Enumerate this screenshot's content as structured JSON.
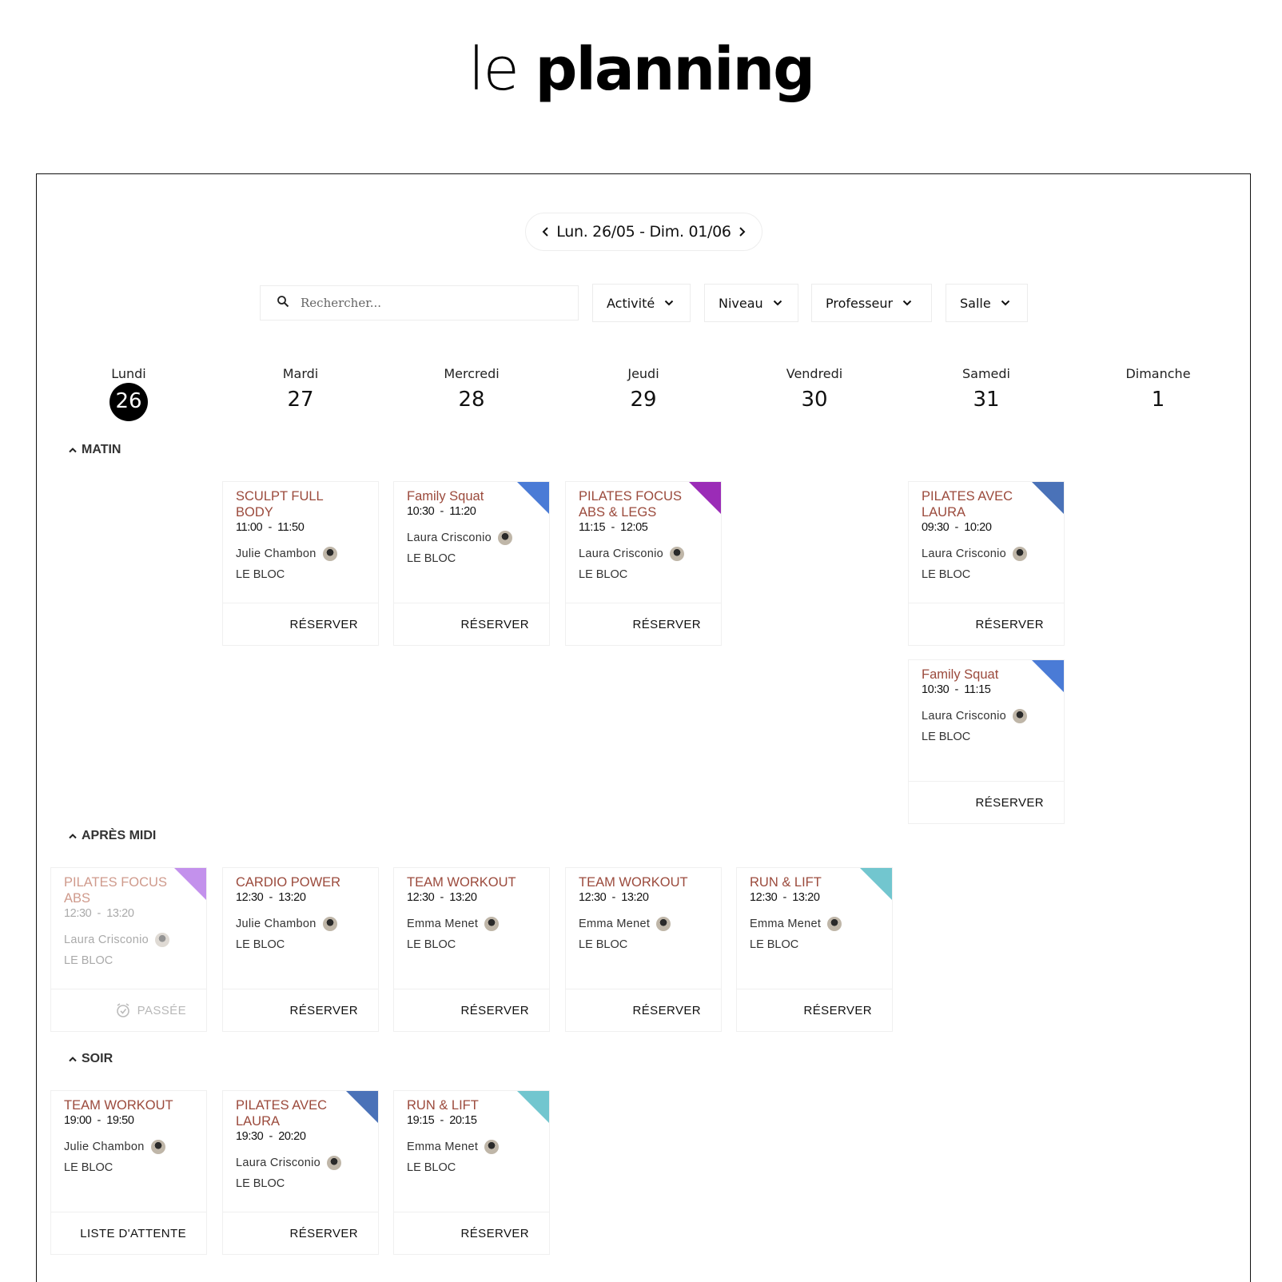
{
  "page": {
    "title_light": "le",
    "title_bold": "planning"
  },
  "week_nav": {
    "label": "Lun. 26/05 - Dim. 01/06"
  },
  "search": {
    "placeholder": "Rechercher..."
  },
  "filters": [
    "Activité",
    "Niveau",
    "Professeur",
    "Salle"
  ],
  "days": [
    {
      "name": "Lundi",
      "num": "26",
      "today": true
    },
    {
      "name": "Mardi",
      "num": "27"
    },
    {
      "name": "Mercredi",
      "num": "28"
    },
    {
      "name": "Jeudi",
      "num": "29"
    },
    {
      "name": "Vendredi",
      "num": "30"
    },
    {
      "name": "Samedi",
      "num": "31"
    },
    {
      "name": "Dimanche",
      "num": "1"
    }
  ],
  "sections": [
    "MATIN",
    "APRÈS MIDI",
    "SOIR"
  ],
  "colors": {
    "blue": "#4a7bd6",
    "purple": "#9b2cb7",
    "lavender": "#c391ec",
    "teal": "#72c6cf",
    "steel": "#4a72b8",
    "title_red": "#9b4a3c"
  },
  "classes": [
    {
      "section": 0,
      "day": 1,
      "slot": 0,
      "title": "SCULPT FULL BODY",
      "time": "11:00  -  11:50",
      "coach": "Julie Chambon",
      "room": "LE BLOC",
      "action": "RÉSERVER",
      "tag": ""
    },
    {
      "section": 0,
      "day": 2,
      "slot": 0,
      "title": "Family Squat",
      "time": "10:30  -  11:20",
      "coach": "Laura Crisconio",
      "room": "LE BLOC",
      "action": "RÉSERVER",
      "tag": "blue"
    },
    {
      "section": 0,
      "day": 3,
      "slot": 0,
      "title": "PILATES FOCUS ABS & LEGS",
      "time": "11:15  -  12:05",
      "coach": "Laura Crisconio",
      "room": "LE BLOC",
      "action": "RÉSERVER",
      "tag": "purple"
    },
    {
      "section": 0,
      "day": 5,
      "slot": 0,
      "title": "PILATES AVEC LAURA",
      "time": "09:30  -  10:20",
      "coach": "Laura Crisconio",
      "room": "LE BLOC",
      "action": "RÉSERVER",
      "tag": "steel"
    },
    {
      "section": 0,
      "day": 5,
      "slot": 1,
      "title": "Family Squat",
      "time": "10:30  -  11:15",
      "coach": "Laura Crisconio",
      "room": "LE BLOC",
      "action": "RÉSERVER",
      "tag": "blue"
    },
    {
      "section": 1,
      "day": 0,
      "slot": 0,
      "title": "PILATES FOCUS ABS",
      "time": "12:30  -  13:20",
      "coach": "Laura Crisconio",
      "room": "LE BLOC",
      "action": "PASSÉE",
      "tag": "lavender",
      "past": true
    },
    {
      "section": 1,
      "day": 1,
      "slot": 0,
      "title": "CARDIO POWER",
      "time": "12:30  -  13:20",
      "coach": "Julie Chambon",
      "room": "LE BLOC",
      "action": "RÉSERVER",
      "tag": ""
    },
    {
      "section": 1,
      "day": 2,
      "slot": 0,
      "title": "TEAM WORKOUT",
      "time": "12:30  -  13:20",
      "coach": "Emma Menet",
      "room": "LE BLOC",
      "action": "RÉSERVER",
      "tag": ""
    },
    {
      "section": 1,
      "day": 3,
      "slot": 0,
      "title": "TEAM WORKOUT",
      "time": "12:30  -  13:20",
      "coach": "Emma Menet",
      "room": "LE BLOC",
      "action": "RÉSERVER",
      "tag": ""
    },
    {
      "section": 1,
      "day": 4,
      "slot": 0,
      "title": "RUN & LIFT",
      "time": "12:30  -  13:20",
      "coach": "Emma Menet",
      "room": "LE BLOC",
      "action": "RÉSERVER",
      "tag": "teal"
    },
    {
      "section": 2,
      "day": 0,
      "slot": 0,
      "title": "TEAM WORKOUT",
      "time": "19:00  -  19:50",
      "coach": "Julie Chambon",
      "room": "LE BLOC",
      "action": "LISTE D'ATTENTE",
      "tag": ""
    },
    {
      "section": 2,
      "day": 1,
      "slot": 0,
      "title": "PILATES AVEC LAURA",
      "time": "19:30  -  20:20",
      "coach": "Laura Crisconio",
      "room": "LE BLOC",
      "action": "RÉSERVER",
      "tag": "steel"
    },
    {
      "section": 2,
      "day": 2,
      "slot": 0,
      "title": "RUN & LIFT",
      "time": "19:15  -  20:15",
      "coach": "Emma Menet",
      "room": "LE BLOC",
      "action": "RÉSERVER",
      "tag": "teal"
    }
  ]
}
